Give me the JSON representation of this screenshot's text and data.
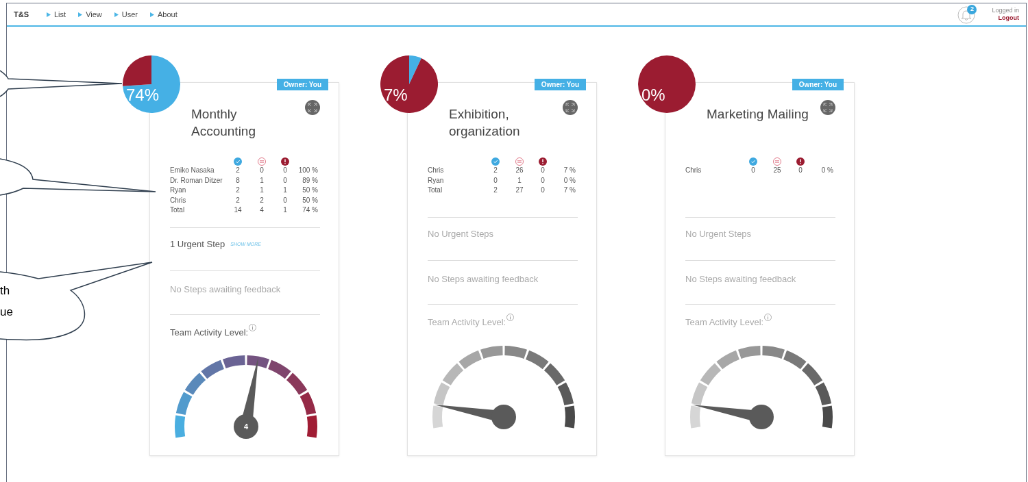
{
  "nav": {
    "brand": "T&S",
    "items": [
      "List",
      "View",
      "User",
      "About"
    ]
  },
  "user": {
    "notification_count": "2",
    "status": "Logged in",
    "logout": "Logout"
  },
  "projects": [
    {
      "progress": {
        "label": "74%",
        "chart_data": {
          "type": "pie",
          "values": [
            74,
            26
          ]
        }
      },
      "owner": "Owner: You",
      "title": "Monthly Accounting",
      "stats": [
        {
          "name": "Emiko Nasaka",
          "done": "2",
          "pending": "0",
          "blocked": "0",
          "percent": "100 %"
        },
        {
          "name": "Dr. Roman Ditzer",
          "done": "8",
          "pending": "1",
          "blocked": "0",
          "percent": "89 %"
        },
        {
          "name": "Ryan",
          "done": "2",
          "pending": "1",
          "blocked": "1",
          "percent": "50 %"
        },
        {
          "name": "Chris",
          "done": "2",
          "pending": "2",
          "blocked": "0",
          "percent": "50 %"
        },
        {
          "name": "Total",
          "done": "14",
          "pending": "4",
          "blocked": "1",
          "percent": "74 %"
        }
      ],
      "urgent": {
        "text": "1 Urgent Step",
        "link": "SHOW MORE",
        "active": true
      },
      "feedback": "No Steps awaiting feedback",
      "activity": {
        "label": "Team Activity Level:",
        "kind": "colored",
        "level": 0.55,
        "reading": "4"
      }
    },
    {
      "progress": {
        "label": "7%",
        "chart_data": {
          "type": "pie",
          "values": [
            7,
            93
          ]
        }
      },
      "owner": "Owner: You",
      "title": "Exhibition, organization",
      "stats": [
        {
          "name": "Chris",
          "done": "2",
          "pending": "26",
          "blocked": "0",
          "percent": "7 %"
        },
        {
          "name": "Ryan",
          "done": "0",
          "pending": "1",
          "blocked": "0",
          "percent": "0 %"
        },
        {
          "name": "Total",
          "done": "2",
          "pending": "27",
          "blocked": "0",
          "percent": "7 %"
        }
      ],
      "urgent": {
        "text": "No Urgent Steps",
        "active": false
      },
      "feedback": "No Steps awaiting feedback",
      "activity": {
        "label": "Team Activity Level:",
        "kind": "grey",
        "level": 0.1
      }
    },
    {
      "progress": {
        "label": "0%",
        "chart_data": {
          "type": "pie",
          "values": [
            0,
            100
          ]
        }
      },
      "owner": "Owner: You",
      "title": "Marketing Mailing",
      "stats": [
        {
          "name": "Chris",
          "done": "0",
          "pending": "25",
          "blocked": "0",
          "percent": "0 %"
        }
      ],
      "urgent": {
        "text": "No Urgent Steps",
        "active": false
      },
      "feedback": "No Steps awaiting feedback",
      "activity": {
        "label": "Team Activity Level:",
        "kind": "grey",
        "level": 0.1
      }
    }
  ],
  "callout": {
    "lines": [
      "th",
      "ue"
    ]
  }
}
